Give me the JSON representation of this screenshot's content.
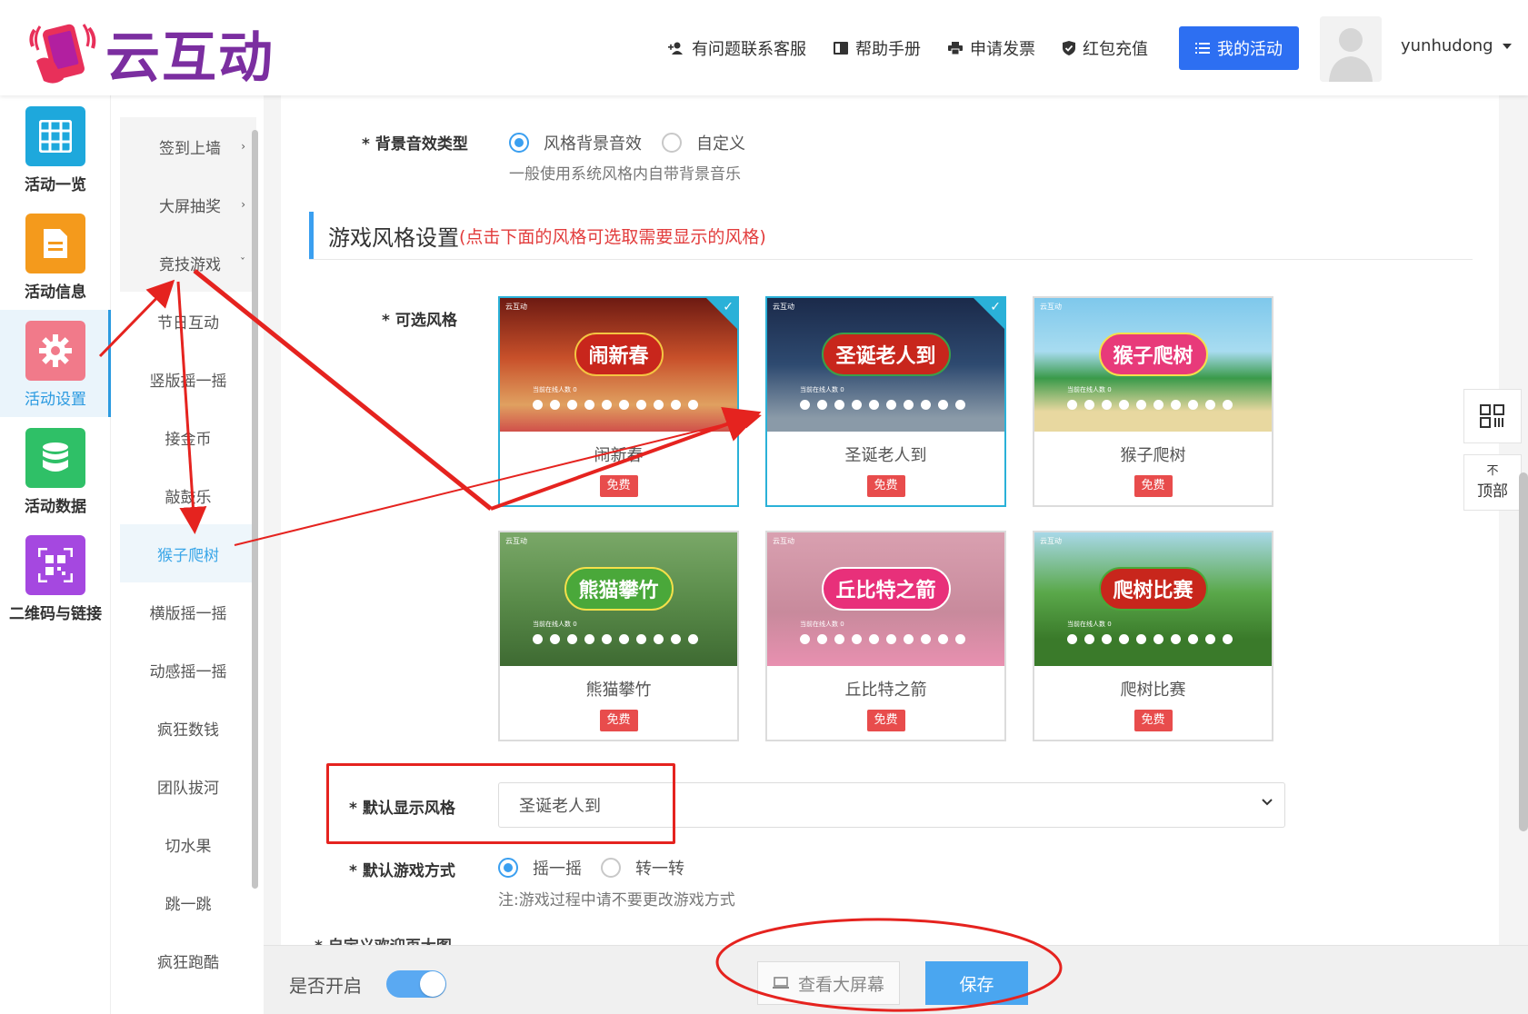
{
  "brand": {
    "logo_text": "云互动"
  },
  "top_nav": {
    "support": "有问题联系客服",
    "manual": "帮助手册",
    "invoice": "申请发票",
    "recharge": "红包充值",
    "my_activity": "我的活动",
    "username": "yunhudong"
  },
  "main_sidebar": [
    {
      "label": "活动一览",
      "color": "#1ea8dc"
    },
    {
      "label": "活动信息",
      "color": "#f49a1c"
    },
    {
      "label": "活动设置",
      "color": "#f17a8a"
    },
    {
      "label": "活动数据",
      "color": "#2fc067"
    },
    {
      "label": "二维码与链接",
      "color": "#a548e0"
    }
  ],
  "sub_sidebar": {
    "items": [
      "签到上墙",
      "大屏抽奖",
      "竞技游戏",
      "节日互动",
      "竖版摇一摇",
      "接金币",
      "敲鼓乐",
      "猴子爬树",
      "横版摇一摇",
      "动感摇一摇",
      "疯狂数钱",
      "团队拔河",
      "切水果",
      "跳一跳",
      "疯狂跑酷"
    ]
  },
  "form": {
    "bg_sound_label": "背景音效类型",
    "bg_sound_options": [
      "风格背景音效",
      "自定义"
    ],
    "bg_sound_hint": "一般使用系统风格内自带背景音乐",
    "section_title": "游戏风格设置",
    "section_note": "(点击下面的风格可选取需要显示的风格)",
    "styles_label": "可选风格",
    "styles": [
      {
        "name": "闹新春",
        "badge": "免费",
        "thumb_title": "闹新春",
        "checked": true
      },
      {
        "name": "圣诞老人到",
        "badge": "免费",
        "thumb_title": "圣诞老人到",
        "checked": true
      },
      {
        "name": "猴子爬树",
        "badge": "免费",
        "thumb_title": "猴子爬树",
        "checked": false
      },
      {
        "name": "熊猫攀竹",
        "badge": "免费",
        "thumb_title": "熊猫攀竹",
        "checked": false
      },
      {
        "name": "丘比特之箭",
        "badge": "免费",
        "thumb_title": "丘比特之箭",
        "checked": false
      },
      {
        "name": "爬树比赛",
        "badge": "免费",
        "thumb_title": "爬树比赛",
        "checked": false
      }
    ],
    "thumb_brand": "云互动",
    "thumb_count": "当前在线人数 0",
    "default_style_label": "默认显示风格",
    "default_style_value": "圣诞老人到",
    "play_mode_label": "默认游戏方式",
    "play_mode_options": [
      "摇一摇",
      "转一转"
    ],
    "play_mode_hint": "注:游戏过程中请不要更改游戏方式",
    "welcome_image_label": "自定义欢迎页大图"
  },
  "bottom_bar": {
    "toggle_label": "是否开启",
    "view_screen": "查看大屏幕",
    "save": "保存"
  },
  "float_buttons": {
    "top_label": "顶部",
    "top_arrow": "不"
  },
  "colors": {
    "accent": "#2d6ff2",
    "highlight": "#3a9ff0",
    "annotation": "#e5231f",
    "free_badge": "#e84c4c"
  }
}
